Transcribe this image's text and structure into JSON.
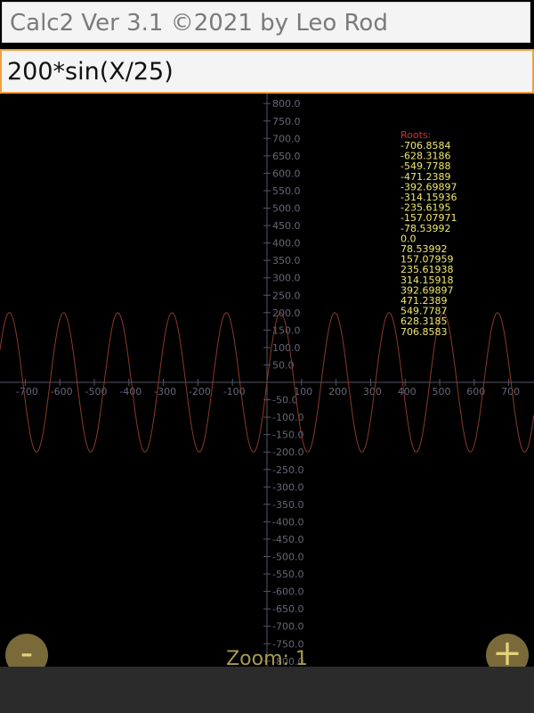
{
  "app": {
    "title": "Calc2 Ver 3.1 ©2021 by Leo Rod"
  },
  "expression": {
    "value": "200*sin(X/25)"
  },
  "graph": {
    "x_ticks": [
      "-700",
      "-600",
      "-500",
      "-400",
      "-300",
      "-200",
      "-100",
      "100",
      "200",
      "300",
      "400",
      "500",
      "600",
      "700"
    ],
    "y_ticks": [
      "800.0",
      "750.0",
      "700.0",
      "650.0",
      "600.0",
      "550.0",
      "500.0",
      "450.0",
      "400.0",
      "350.0",
      "300.0",
      "250.0",
      "200.0",
      "150.0",
      "100.0",
      "50.0",
      "-50.0",
      "-100.0",
      "-150.0",
      "-200.0",
      "-250.0",
      "-300.0",
      "-350.0",
      "-400.0",
      "-450.0",
      "-500.0",
      "-550.0",
      "-600.0",
      "-650.0",
      "-700.0",
      "-750.0",
      "-800.0"
    ],
    "roots_title": "Roots:",
    "roots": [
      "-706.8584",
      "-628.3186",
      "-549.7788",
      "-471.2389",
      "-392.69897",
      "-314.15936",
      "-235.6195",
      "-157.07971",
      "-78.53992",
      "0.0",
      "78.53992",
      "157.07959",
      "235.61938",
      "314.15918",
      "392.69897",
      "471.2389",
      "549.7787",
      "628.3185",
      "706.8583"
    ],
    "curve": {
      "amplitude": 200,
      "divisor": 25
    },
    "colors": {
      "axis": "#555566",
      "tick_label": "#666677",
      "curve": "#8a3a2a",
      "roots_title": "#d03030",
      "roots": "#f0e870"
    }
  },
  "zoom": {
    "minus_label": "-",
    "plus_label": "+",
    "label": "Zoom: 1"
  }
}
